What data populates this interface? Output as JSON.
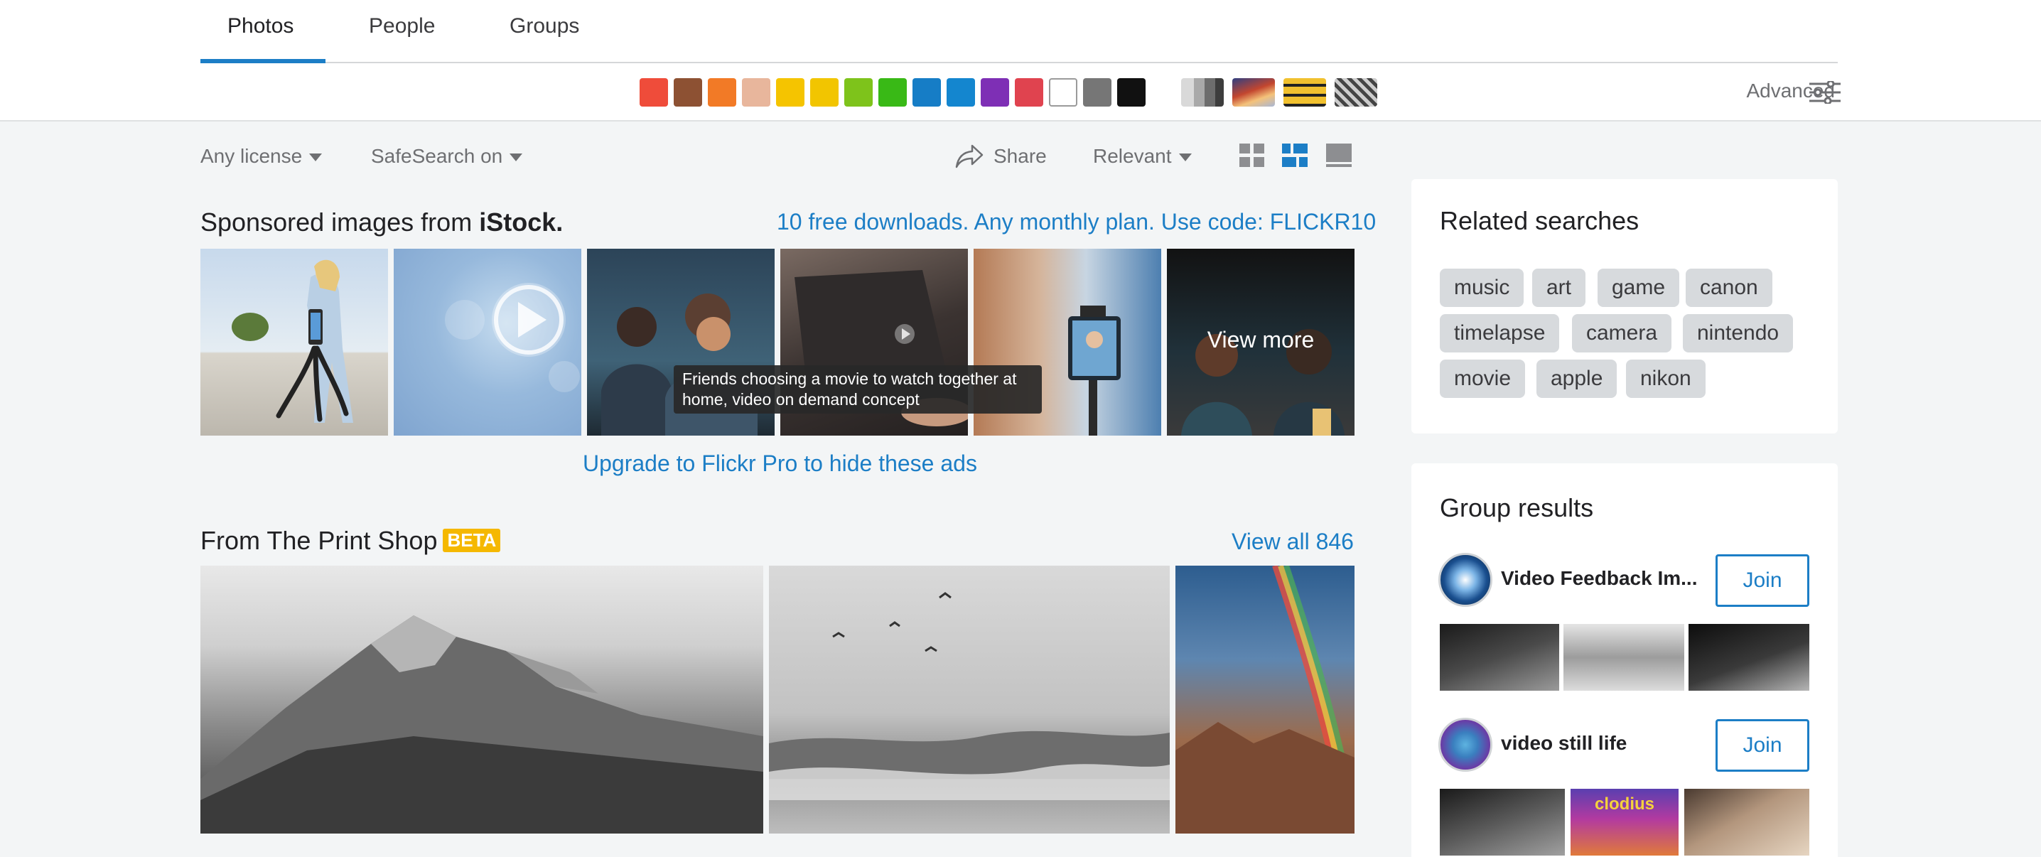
{
  "tabs": [
    {
      "label": "Photos",
      "active": true
    },
    {
      "label": "People",
      "active": false
    },
    {
      "label": "Groups",
      "active": false
    }
  ],
  "color_swatches": [
    "#ef4c3a",
    "#8d5133",
    "#f27a26",
    "#e8b69c",
    "#f5c400",
    "#f2c500",
    "#7ec31b",
    "#39b916",
    "#167dc6",
    "#1486cf",
    "#7e2fb5",
    "#e0434f",
    "#ffffff",
    "#767676",
    "#111111"
  ],
  "style_filters": [
    "gray-filter-icon",
    "color-filter-icon",
    "pattern-filter-icon",
    "texture-filter-icon"
  ],
  "advanced": {
    "label": "Advanced"
  },
  "filters": {
    "license": "Any license",
    "safesearch": "SafeSearch on",
    "share": "Share",
    "sort": "Relevant"
  },
  "sponsored": {
    "title_prefix": "Sponsored images from",
    "brand": "iStock.",
    "promo": "10 free downloads. Any monthly plan. Use code: FLICKR10",
    "view_more": "View more",
    "tooltip": "Friends choosing a movie to watch together at home, video on demand concept",
    "upgrade": "Upgrade to Flickr Pro to hide these ads"
  },
  "print_shop": {
    "title": "From The Print Shop",
    "badge": "BETA",
    "view_all": "View all 846"
  },
  "related": {
    "title": "Related searches",
    "chips": [
      "music",
      "art",
      "game",
      "canon",
      "timelapse",
      "camera",
      "nintendo",
      "movie",
      "apple",
      "nikon"
    ]
  },
  "groups": {
    "title": "Group results",
    "items": [
      {
        "name": "Video Feedback Im...",
        "join": "Join"
      },
      {
        "name": "video still life",
        "join": "Join"
      }
    ],
    "thumb_caption": "clodius"
  },
  "colors": {
    "accent": "#1c7ec6",
    "beta": "#f5b800"
  }
}
